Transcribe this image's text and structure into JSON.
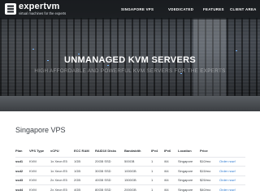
{
  "brand": {
    "name": "expertvm",
    "tagline": "virtual machines for the experts"
  },
  "nav": {
    "items": [
      "SINGAPORE VPS",
      "VDEDICATED",
      "FEATURES",
      "CLIENT AREA"
    ]
  },
  "hero": {
    "title": "UNMANAGED KVM SERVERS",
    "subtitle": "HIGH AFFORDABLE AND POWERFUL KVM SERVERS FOR THE EXPERTS"
  },
  "section": {
    "title": "Singapore VPS"
  },
  "table": {
    "headers": [
      "Plan",
      "VPS Type",
      "vCPU",
      "ECC RAM",
      "RAID10 Disks",
      "Bandwidth",
      "IPv4",
      "IPv6",
      "Location",
      "Price",
      ""
    ],
    "rows": [
      [
        "ssd1",
        "KVM",
        "1x Xeon E5",
        "1GB",
        "20GB SSD",
        "500GB",
        "1",
        "/64",
        "Singapore",
        "$10/mo",
        "Order now!"
      ],
      [
        "ssd2",
        "KVM",
        "1x Xeon E5",
        "1GB",
        "30GB SSD",
        "1000GB",
        "1",
        "/64",
        "Singapore",
        "$15/mo",
        "Order now!"
      ],
      [
        "ssd3",
        "KVM",
        "2x Xeon E5",
        "2GB",
        "40GB SSD",
        "1500GB",
        "1",
        "/64",
        "Singapore",
        "$25/mo",
        "Order now!"
      ],
      [
        "ssd4",
        "KVM",
        "2x Xeon E5",
        "4GB",
        "80GB SSD",
        "2000GB",
        "1",
        "/64",
        "Singapore",
        "$40/mo",
        "Order now!"
      ]
    ]
  },
  "colors": {
    "link": "#2a78d0",
    "nav_bg": "#16181b",
    "text": "#3b4046"
  }
}
